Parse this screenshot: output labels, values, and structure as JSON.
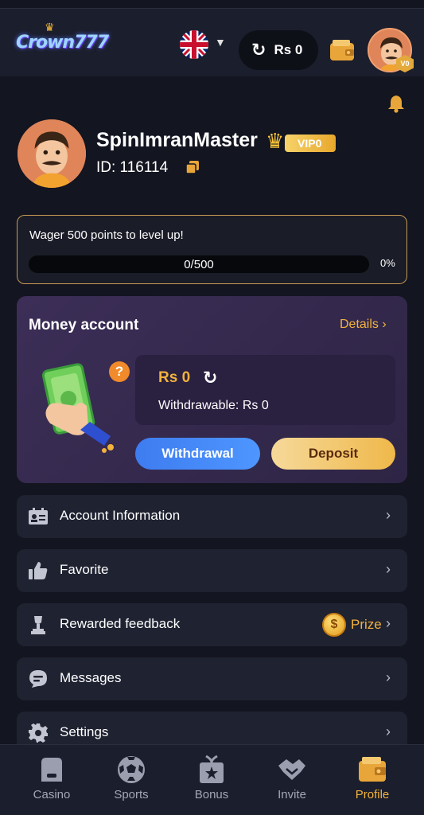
{
  "header": {
    "logo_text": "Crown777",
    "language": "UK",
    "balance": "Rs 0",
    "vip_level_badge": "V0"
  },
  "profile": {
    "username": "SpinImranMaster",
    "vip_label": "VIP0",
    "id_text": "ID: 116114"
  },
  "wager": {
    "message": "Wager 500 points to level up!",
    "progress_text": "0/500",
    "progress_fraction": 0,
    "percent_text": "0%"
  },
  "money_account": {
    "title": "Money account",
    "details_label": "Details",
    "balance": "Rs 0",
    "withdrawable": "Withdrawable: Rs 0",
    "withdraw_label": "Withdrawal",
    "deposit_label": "Deposit"
  },
  "menu": {
    "items": [
      {
        "label": "Account Information",
        "icon": "id-card-icon"
      },
      {
        "label": "Favorite",
        "icon": "thumbs-up-icon"
      },
      {
        "label": "Rewarded feedback",
        "icon": "trophy-icon",
        "badge": "Prize"
      },
      {
        "label": "Messages",
        "icon": "chat-icon"
      },
      {
        "label": "Settings",
        "icon": "gear-icon"
      }
    ]
  },
  "bottom_nav": {
    "items": [
      {
        "label": "Casino",
        "icon": "casino-icon"
      },
      {
        "label": "Sports",
        "icon": "soccer-ball-icon"
      },
      {
        "label": "Bonus",
        "icon": "gift-icon"
      },
      {
        "label": "Invite",
        "icon": "handshake-icon"
      },
      {
        "label": "Profile",
        "icon": "wallet-icon"
      }
    ],
    "active": "Profile"
  },
  "colors": {
    "accent": "#f2b23c",
    "background": "#131520",
    "card": "#1f2231",
    "primary_button": "#4e96ff"
  }
}
